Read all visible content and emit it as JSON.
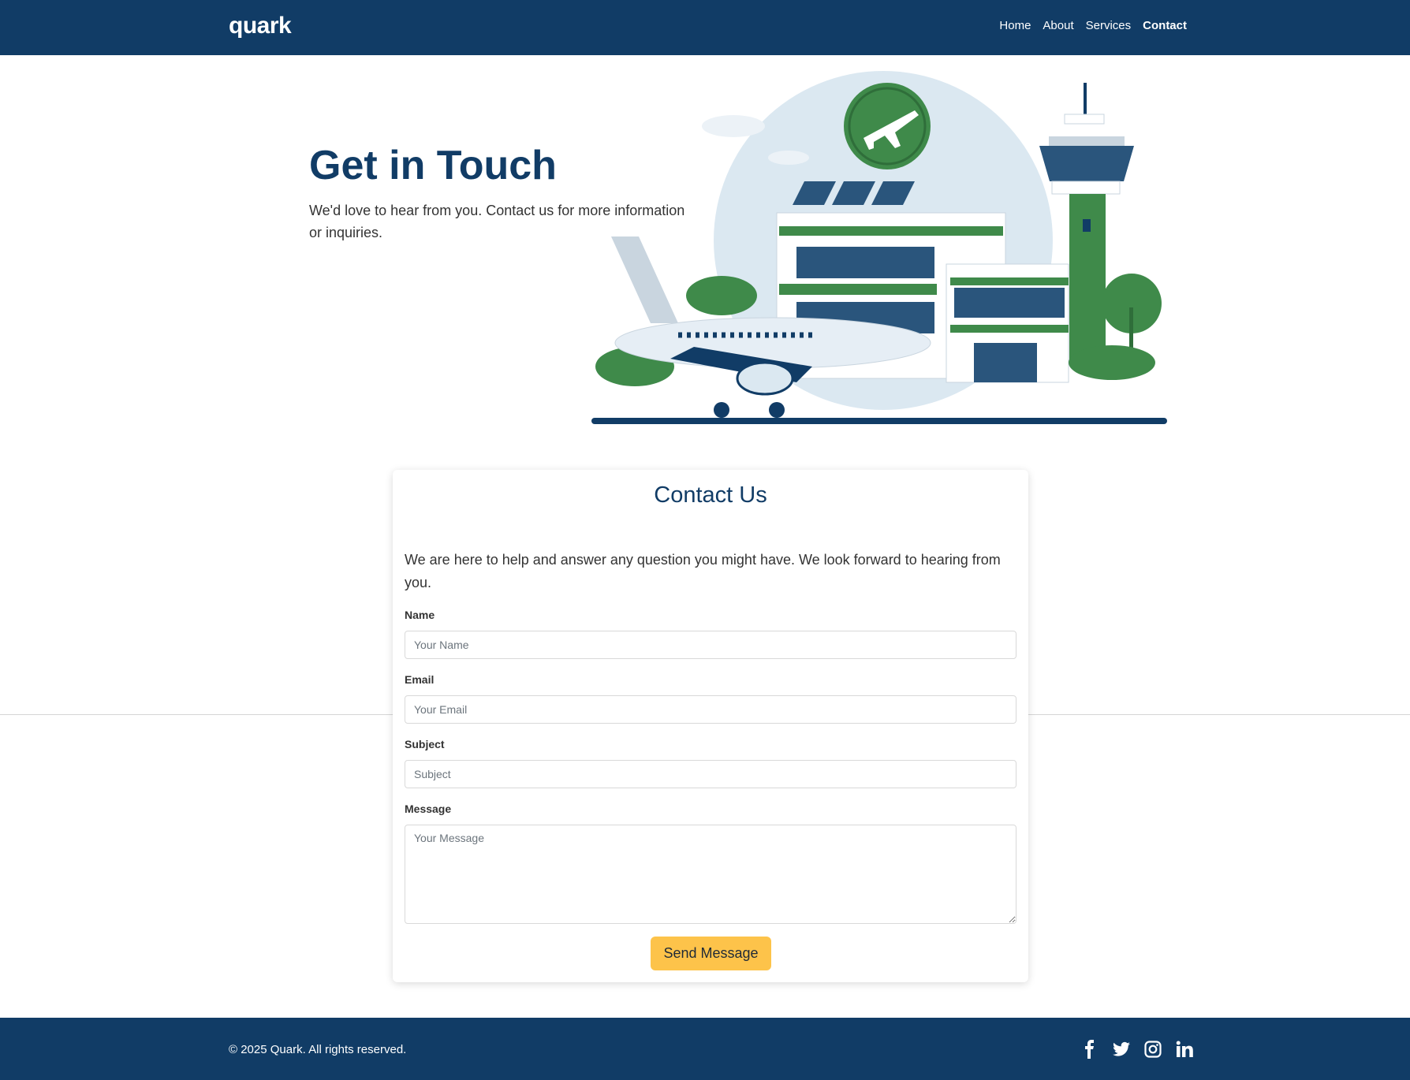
{
  "navbar": {
    "brand": "quark",
    "links": [
      {
        "label": "Home",
        "active": false
      },
      {
        "label": "About",
        "active": false
      },
      {
        "label": "Services",
        "active": false
      },
      {
        "label": "Contact",
        "active": true
      }
    ]
  },
  "hero": {
    "title": "Get in Touch",
    "subtitle": "We'd love to hear from you. Contact us for more information or inquiries."
  },
  "contact_form": {
    "title": "Contact Us",
    "intro": "We are here to help and answer any question you might have. We look forward to hearing from you.",
    "fields": {
      "name": {
        "label": "Name",
        "placeholder": "Your Name",
        "value": ""
      },
      "email": {
        "label": "Email",
        "placeholder": "Your Email",
        "value": ""
      },
      "subject": {
        "label": "Subject",
        "placeholder": "Subject",
        "value": ""
      },
      "message": {
        "label": "Message",
        "placeholder": "Your Message",
        "value": ""
      }
    },
    "submit_label": "Send Message"
  },
  "footer": {
    "copyright": "© 2025 Quark. All rights reserved.",
    "social_icons": [
      "facebook-icon",
      "twitter-icon",
      "instagram-icon",
      "linkedin-icon"
    ]
  },
  "colors": {
    "primary": "#113c66",
    "accent": "#fdc34a",
    "green": "#3f8a4a",
    "light_blue": "#d8e6f0"
  }
}
